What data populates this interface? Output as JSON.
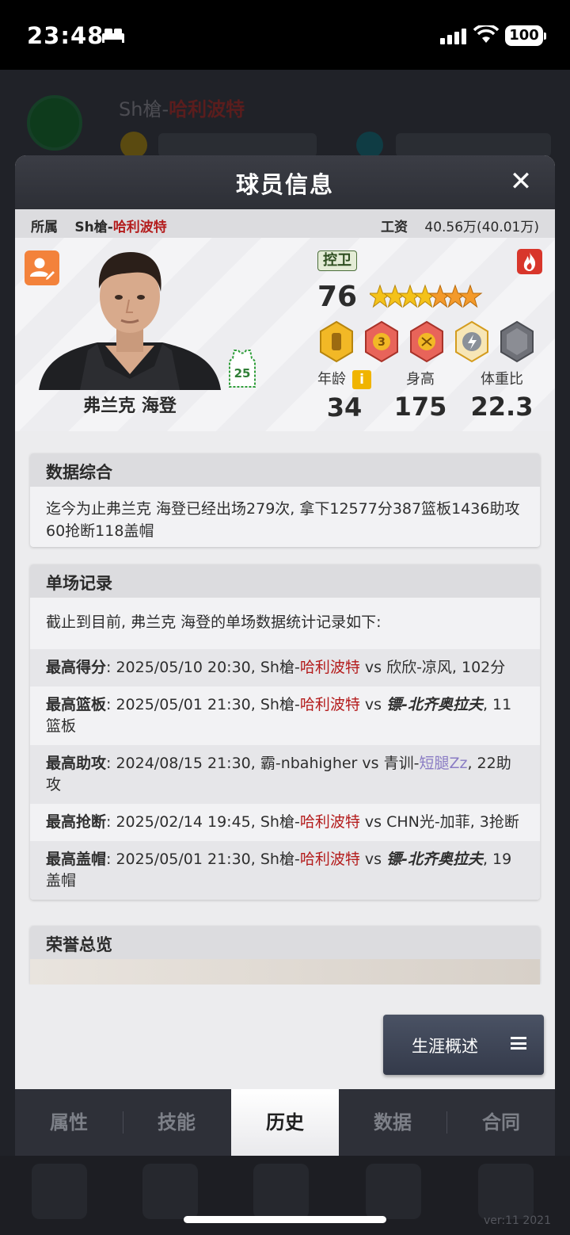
{
  "status_bar": {
    "time": "23:48",
    "battery": "100"
  },
  "background": {
    "team_prefix": "Sh槍-",
    "team_highlight": "哈利波特",
    "version": "ver:11  2021"
  },
  "modal": {
    "title": "球员信息",
    "close_label": "✕",
    "affiliation_key": "所属",
    "team_prefix": "Sh槍-",
    "team_highlight": "哈利波特",
    "salary_key": "工资",
    "salary_value": "40.56万(40.01万)"
  },
  "player": {
    "name": "弗兰克 海登",
    "position": "控卫",
    "rating": "76",
    "jersey_number": "25",
    "star_rating": 5,
    "stats": [
      {
        "label": "年龄",
        "value": "34"
      },
      {
        "label": "身高",
        "value": "175"
      },
      {
        "label": "体重比",
        "value": "22.3"
      }
    ]
  },
  "summary": {
    "title": "数据综合",
    "text": "迄今为止弗兰克 海登已经出场279次, 拿下12577分387篮板1436助攻60抢断118盖帽"
  },
  "records": {
    "title": "单场记录",
    "intro": "截止到目前, 弗兰克 海登的单场数据统计记录如下:",
    "items": [
      {
        "label": "最高得分",
        "date": ": 2025/05/10 20:30, ",
        "team_a": "Sh槍-",
        "team_a_hl": "哈利波特",
        "vs": " vs ",
        "team_b": "欣欣-凉风",
        "team_b_hl": "",
        "result": ", 102分"
      },
      {
        "label": "最高篮板",
        "date": ": 2025/05/01 21:30, ",
        "team_a": "Sh槍-",
        "team_a_hl": "哈利波特",
        "vs": " vs ",
        "team_b": "",
        "team_b_hl": "镖-北齐奥拉夫",
        "result": ", 11篮板"
      },
      {
        "label": "最高助攻",
        "date": ": 2024/08/15 21:30, ",
        "team_a": "霸-nbahigher",
        "team_a_hl": "",
        "vs": " vs ",
        "team_b": "青训-",
        "team_b_hl": "短腿Zz",
        "result": ", 22助攻"
      },
      {
        "label": "最高抢断",
        "date": ": 2025/02/14 19:45, ",
        "team_a": "Sh槍-",
        "team_a_hl": "哈利波特",
        "vs": " vs ",
        "team_b": "CHN光-加菲",
        "team_b_hl": "",
        "result": ", 3抢断"
      },
      {
        "label": "最高盖帽",
        "date": ": 2025/05/01 21:30, ",
        "team_a": "Sh槍-",
        "team_a_hl": "哈利波特",
        "vs": " vs ",
        "team_b": "",
        "team_b_hl": "镖-北齐奥拉夫",
        "result": ", 19盖帽"
      }
    ]
  },
  "honors": {
    "title": "荣誉总览"
  },
  "career_button": {
    "label": "生涯概述"
  },
  "tabs": [
    {
      "label": "属性",
      "active": false
    },
    {
      "label": "技能",
      "active": false
    },
    {
      "label": "历史",
      "active": true
    },
    {
      "label": "数据",
      "active": false
    },
    {
      "label": "合同",
      "active": false
    }
  ],
  "colors": {
    "accent_red": "#b41c1c",
    "link_purple": "#8a7cc4",
    "edit_orange": "#f3823b",
    "header_dark": "#2d2f36"
  }
}
